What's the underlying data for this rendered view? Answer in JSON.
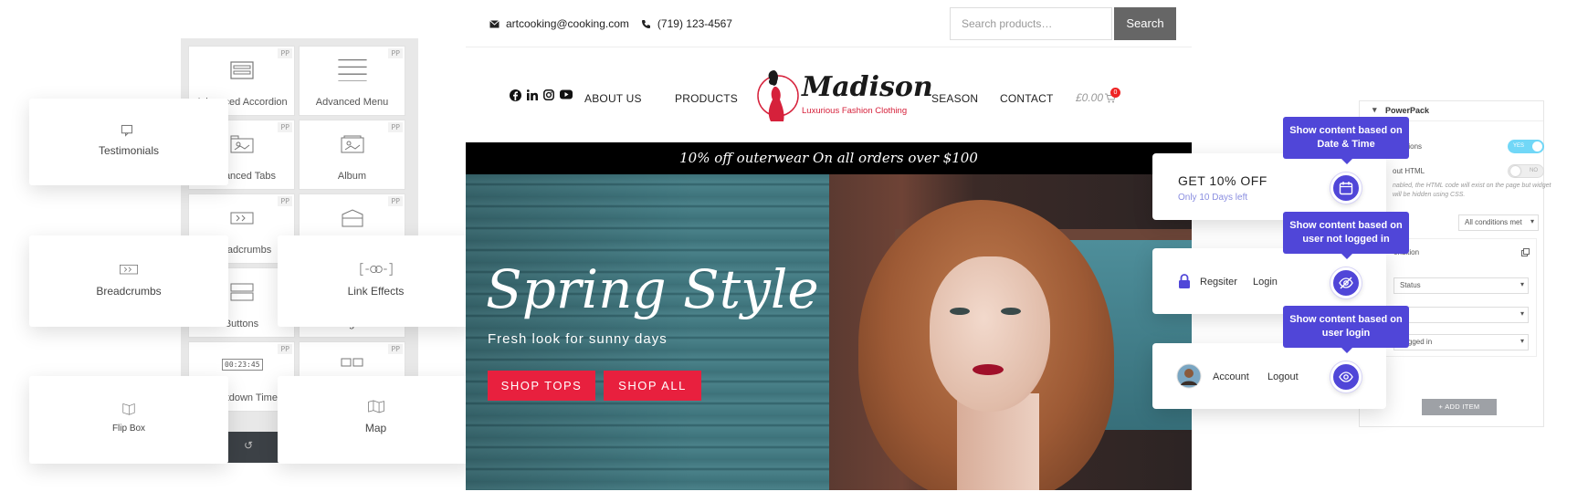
{
  "widgets": {
    "badge": "PP",
    "tiles": [
      {
        "label": "Advanced Accordion"
      },
      {
        "label": "Advanced Menu"
      },
      {
        "label": "Advanced Tabs"
      },
      {
        "label": "Album"
      },
      {
        "label": "Breadcrumbs"
      },
      {
        "label": ""
      },
      {
        "label": "Buttons"
      },
      {
        "label": "Categories"
      },
      {
        "label": "Countdown Timer"
      },
      {
        "label": ""
      }
    ],
    "countdown_digits": "00:23:45",
    "floating": {
      "testimonials": "Testimonials",
      "breadcrumbs": "Breadcrumbs",
      "link_effects": "Link Effects",
      "flip_box": "Flip Box",
      "map": "Map"
    }
  },
  "site": {
    "email": "artcooking@cooking.com",
    "phone": "(719) 123-4567",
    "search_placeholder": "Search products…",
    "search_button": "Search",
    "nav": {
      "about": "ABOUT US",
      "products": "PRODUCTS",
      "season": "SEASON",
      "contact": "CONTACT"
    },
    "logo": {
      "name": "Madison",
      "tagline": "Luxurious Fashion Clothing"
    },
    "cart": {
      "total": "£0.00",
      "count": "0"
    },
    "promo": "10% off outerwear On all orders over $100",
    "hero": {
      "title": "Spring Style",
      "subtitle": "Fresh look for sunny days",
      "btn_tops": "SHOP TOPS",
      "btn_all": "SHOP ALL"
    }
  },
  "conditions": {
    "offer": {
      "title": "GET 10% OFF",
      "subtitle": "Only 10 Days left"
    },
    "guest": {
      "register": "Regsiter",
      "login": "Login"
    },
    "member": {
      "account": "Account",
      "logout": "Logout"
    },
    "tooltips": {
      "date_time": "Show content based on Date & Time",
      "not_logged": "Show content based on user not logged in",
      "logged": "Show content based on user login"
    }
  },
  "powerpack": {
    "title": "PowerPack",
    "enable_label": "onditions",
    "toggle_on": "YES",
    "raw_html_label": "out HTML",
    "toggle_off": "NO",
    "note": "nabled, the HTML code will exist on the page but widget will be hidden using CSS.",
    "match_value": "All conditions met",
    "condition_label": "ondition",
    "status_value": "Status",
    "logged_value": "Logged in",
    "add_item": "ADD ITEM"
  },
  "colors": {
    "accent_red": "#e8203e",
    "accent_purple": "#5046d8",
    "toggle_blue": "#71d7f7"
  }
}
